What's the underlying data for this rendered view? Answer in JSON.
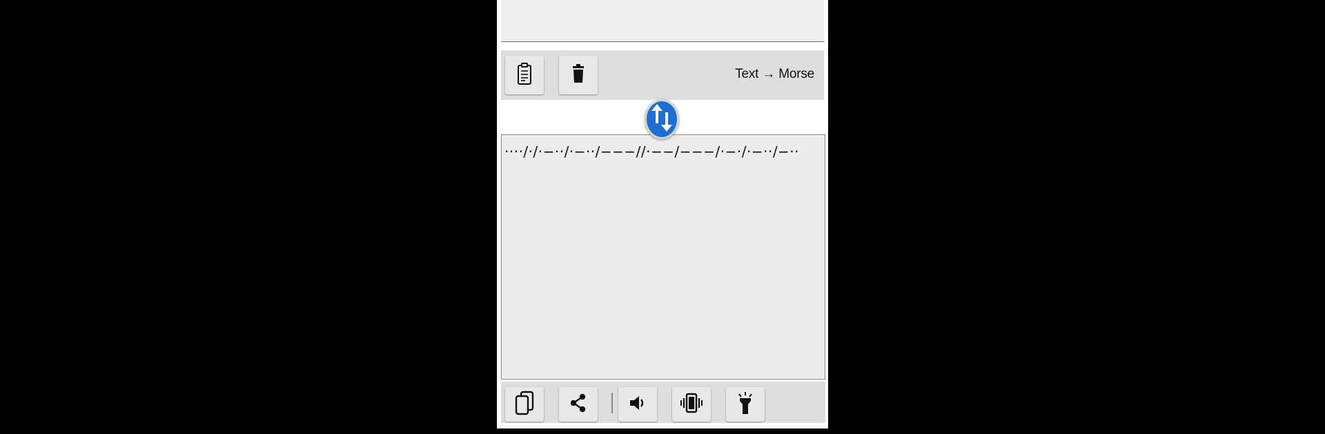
{
  "top_toolbar": {
    "paste_icon": "clipboard-icon",
    "delete_icon": "trash-icon",
    "mode_label": "Text → Morse"
  },
  "swap": {
    "icon": "swap-vertical-arrows-icon",
    "color": "#1f6fd0"
  },
  "output": {
    "morse_text": "····/·/·−··/·−··/−−−//·−−/−−−/·−·/·−··/−··"
  },
  "bottom_toolbar": {
    "copy_icon": "copy-icon",
    "share_icon": "share-icon",
    "sound_icon": "speaker-icon",
    "vibrate_icon": "vibrate-icon",
    "flashlight_icon": "flashlight-icon"
  }
}
